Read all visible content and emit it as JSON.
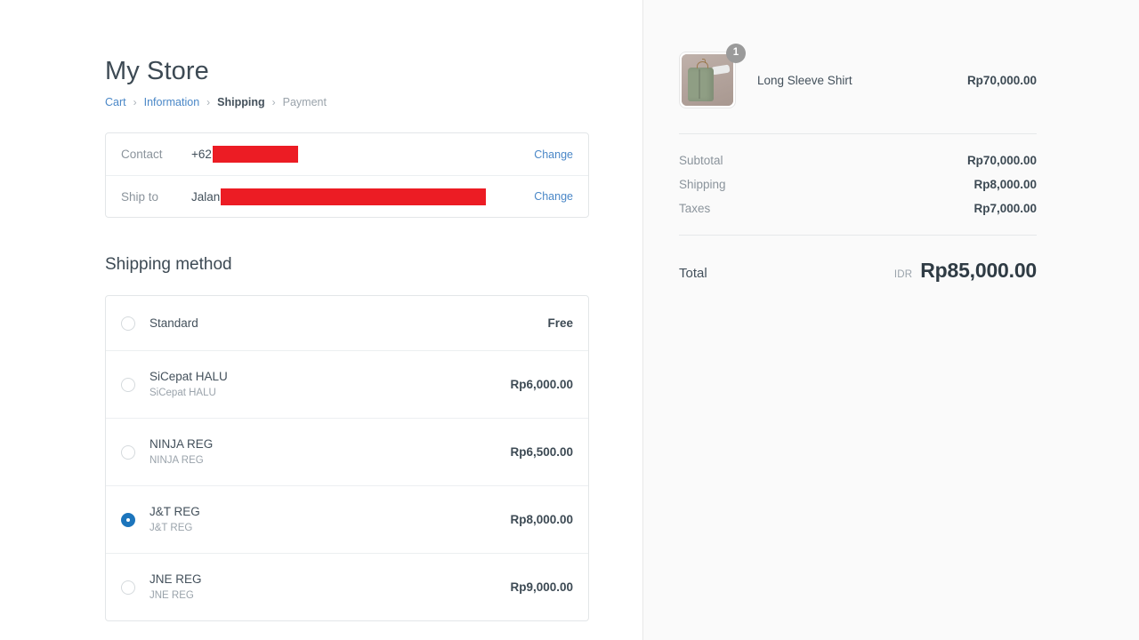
{
  "store": {
    "title": "My Store"
  },
  "breadcrumb": {
    "items": [
      {
        "label": "Cart",
        "state": "link"
      },
      {
        "label": "Information",
        "state": "link"
      },
      {
        "label": "Shipping",
        "state": "current"
      },
      {
        "label": "Payment",
        "state": "upcoming"
      }
    ],
    "separator": "›"
  },
  "review": {
    "rows": [
      {
        "label": "Contact",
        "value_prefix": "+62",
        "redacted": true,
        "change_label": "Change"
      },
      {
        "label": "Ship to",
        "value_prefix": "Jalan",
        "redacted": true,
        "change_label": "Change"
      }
    ],
    "redaction_color": "#ec1c24"
  },
  "shipping": {
    "section_title": "Shipping method",
    "options": [
      {
        "name": "Standard",
        "subtitle": "",
        "price": "Free",
        "selected": false
      },
      {
        "name": "SiCepat HALU",
        "subtitle": "SiCepat HALU",
        "price": "Rp6,000.00",
        "selected": false
      },
      {
        "name": "NINJA REG",
        "subtitle": "NINJA REG",
        "price": "Rp6,500.00",
        "selected": false
      },
      {
        "name": "J&T REG",
        "subtitle": "J&T REG",
        "price": "Rp8,000.00",
        "selected": true
      },
      {
        "name": "JNE REG",
        "subtitle": "JNE REG",
        "price": "Rp9,000.00",
        "selected": false
      }
    ],
    "selected_index": 3,
    "accent_color": "#1c75bc"
  },
  "summary": {
    "line_items": [
      {
        "name": "Long Sleeve Shirt",
        "price": "Rp70,000.00",
        "quantity": "1",
        "image": "long-sleeve-shirt-thumbnail"
      }
    ],
    "totals": [
      {
        "label": "Subtotal",
        "value": "Rp70,000.00"
      },
      {
        "label": "Shipping",
        "value": "Rp8,000.00"
      },
      {
        "label": "Taxes",
        "value": "Rp7,000.00"
      }
    ],
    "grand_total": {
      "label": "Total",
      "currency": "IDR",
      "amount": "Rp85,000.00"
    }
  },
  "colors": {
    "link": "#4a87c7",
    "accent": "#1c75bc",
    "redaction": "#ec1c24",
    "sidebar_bg": "#fafafa",
    "text": "#43505b",
    "muted": "#8b949c"
  }
}
